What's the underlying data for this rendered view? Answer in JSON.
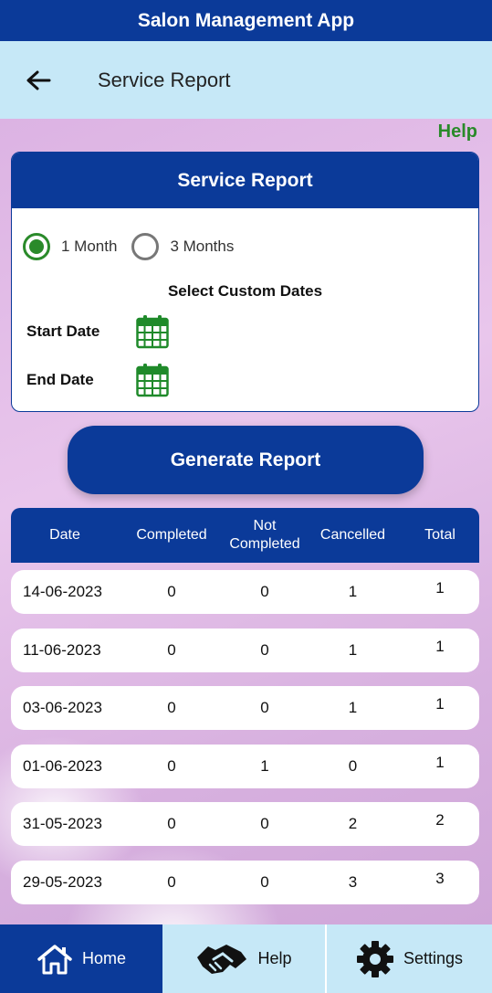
{
  "status_bar": {
    "title": "Salon Management App"
  },
  "app_bar": {
    "title": "Service Report",
    "back_icon": "arrow-left-icon"
  },
  "help_link": "Help",
  "card": {
    "header": "Service Report",
    "options": [
      {
        "label": "1 Month",
        "selected": true
      },
      {
        "label": "3 Months",
        "selected": false
      }
    ],
    "custom_title": "Select Custom Dates",
    "start_label": "Start Date",
    "end_label": "End Date"
  },
  "generate_button": "Generate Report",
  "table": {
    "headers": [
      "Date",
      "Completed",
      "Not Completed",
      "Cancelled",
      "Total"
    ],
    "rows": [
      [
        "14-06-2023",
        "0",
        "0",
        "1",
        "1"
      ],
      [
        "11-06-2023",
        "0",
        "0",
        "1",
        "1"
      ],
      [
        "03-06-2023",
        "0",
        "0",
        "1",
        "1"
      ],
      [
        "01-06-2023",
        "0",
        "1",
        "0",
        "1"
      ],
      [
        "31-05-2023",
        "0",
        "0",
        "2",
        "2"
      ],
      [
        "29-05-2023",
        "0",
        "0",
        "3",
        "3"
      ]
    ]
  },
  "nav": [
    {
      "label": "Home",
      "icon": "home-icon",
      "active": true
    },
    {
      "label": "Help",
      "icon": "handshake-icon",
      "active": false
    },
    {
      "label": "Settings",
      "icon": "gear-icon",
      "active": false
    }
  ],
  "colors": {
    "primary": "#0b3a99",
    "accent_light": "#c6e8f7",
    "green": "#2a8a2a"
  }
}
